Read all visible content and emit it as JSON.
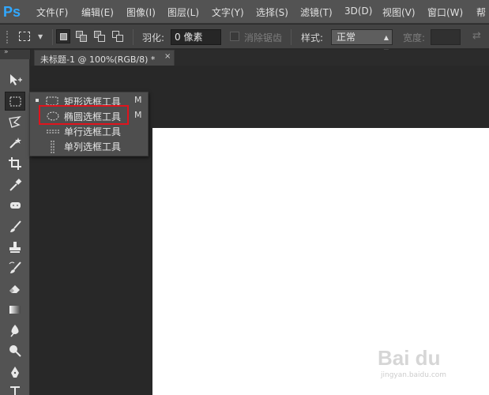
{
  "app": {
    "logo": "Ps",
    "menus": [
      "文件(F)",
      "编辑(E)",
      "图像(I)",
      "图层(L)",
      "文字(Y)",
      "选择(S)",
      "滤镜(T)",
      "3D(D)",
      "视图(V)",
      "窗口(W)",
      "帮"
    ]
  },
  "options": {
    "feather_label": "羽化:",
    "feather_value": "0 像素",
    "antialias_label": "消除锯齿",
    "style_label": "样式:",
    "style_value": "正常",
    "width_label": "宽度:"
  },
  "document": {
    "tab_title": "未标题-1 @ 100%(RGB/8) *",
    "close": "×"
  },
  "flyout": {
    "items": [
      {
        "label": "矩形选框工具",
        "key": "M",
        "active": true,
        "icon": "rect-marquee-icon"
      },
      {
        "label": "椭圆选框工具",
        "key": "M",
        "active": false,
        "icon": "ellipse-marquee-icon"
      },
      {
        "label": "单行选框工具",
        "key": "",
        "active": false,
        "icon": "single-row-marquee-icon"
      },
      {
        "label": "单列选框工具",
        "key": "",
        "active": false,
        "icon": "single-column-marquee-icon"
      }
    ]
  },
  "toolbar": {
    "collapse": "»",
    "tools": [
      "move-tool-icon",
      "marquee-tool-icon",
      "lasso-tool-icon",
      "magic-wand-icon",
      "crop-tool-icon",
      "eyedropper-icon",
      "healing-brush-icon",
      "brush-tool-icon",
      "clone-stamp-icon",
      "history-brush-icon",
      "eraser-icon",
      "gradient-icon",
      "blur-icon",
      "dodge-icon",
      "pen-tool-icon",
      "type-tool-icon"
    ]
  },
  "watermark": {
    "main": "Bai du",
    "sub": "jingyan.baidu.com"
  },
  "colors": {
    "highlight": "#e0141d",
    "logo": "#31a8ff"
  }
}
